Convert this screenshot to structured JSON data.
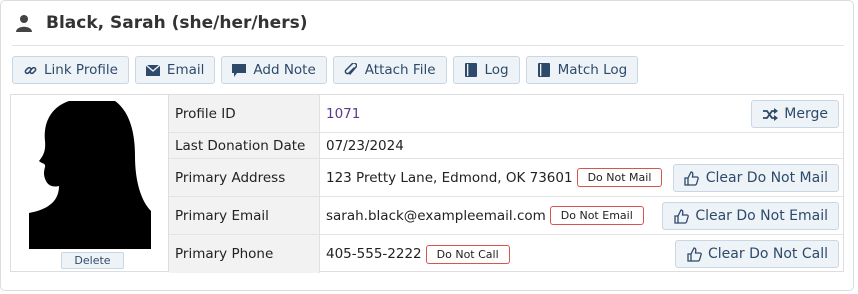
{
  "header": {
    "title": "Black, Sarah (she/her/hers)",
    "icon": "person-icon"
  },
  "toolbar": {
    "buttons": [
      {
        "label": "Link Profile",
        "icon": "link-icon"
      },
      {
        "label": "Email",
        "icon": "envelope-icon"
      },
      {
        "label": "Add Note",
        "icon": "comment-icon"
      },
      {
        "label": "Attach File",
        "icon": "paperclip-icon"
      },
      {
        "label": "Log",
        "icon": "book-icon"
      },
      {
        "label": "Match Log",
        "icon": "book-icon"
      }
    ]
  },
  "photo": {
    "delete_label": "Delete"
  },
  "fields": {
    "profile_id": {
      "label": "Profile ID",
      "value": "1071",
      "action": "Merge"
    },
    "last_donation": {
      "label": "Last Donation Date",
      "value": "07/23/2024"
    },
    "address": {
      "label": "Primary Address",
      "value": "123 Pretty Lane, Edmond, OK 73601",
      "flag": "Do Not Mail",
      "action": "Clear Do Not Mail"
    },
    "email": {
      "label": "Primary Email",
      "value": "sarah.black@exampleemail.com",
      "flag": "Do Not Email",
      "action": "Clear Do Not Email"
    },
    "phone": {
      "label": "Primary Phone",
      "value": "405-555-2222",
      "flag": "Do Not Call",
      "action": "Clear Do Not Call"
    }
  },
  "colors": {
    "accent": "#2e4a6b",
    "button_bg": "#eef3f8",
    "flag_border": "#d9534f",
    "link": "#5a3b8c"
  }
}
